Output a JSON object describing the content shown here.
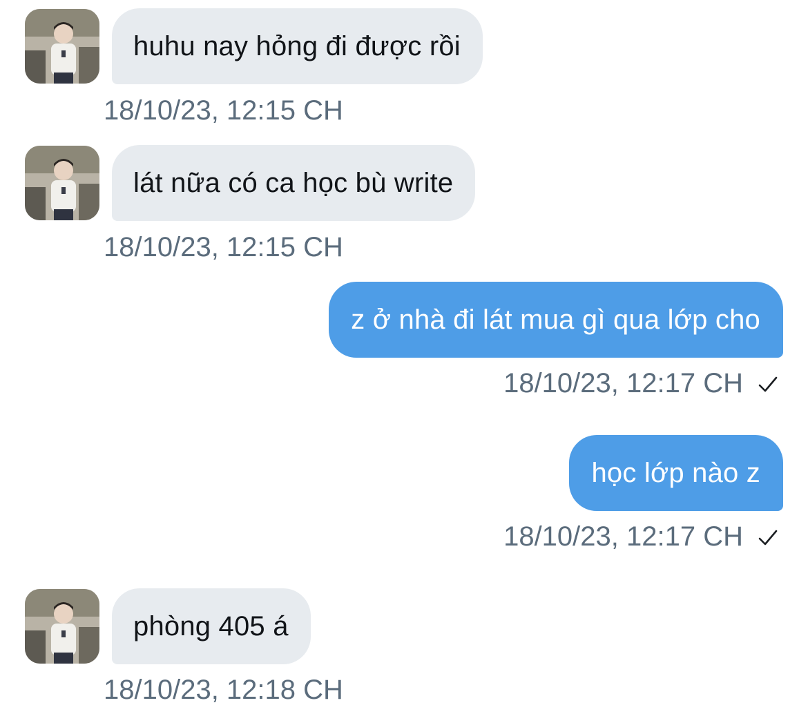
{
  "messages": [
    {
      "direction": "in",
      "text": "huhu nay hỏng đi được rồi",
      "time": "18/10/23, 12:15 CH"
    },
    {
      "direction": "in",
      "text": "lát nữa có ca học bù write",
      "time": "18/10/23, 12:15 CH"
    },
    {
      "direction": "out",
      "text": "z ở nhà đi lát mua gì qua lớp cho",
      "time": "18/10/23, 12:17 CH",
      "status_icon": "checkmark-icon"
    },
    {
      "direction": "out",
      "text": "học lớp nào z",
      "time": "18/10/23, 12:17 CH",
      "status_icon": "checkmark-icon"
    },
    {
      "direction": "in",
      "text": "phòng 405 á",
      "time": "18/10/23, 12:18 CH"
    }
  ],
  "colors": {
    "incoming_bubble": "#e7ebef",
    "outgoing_bubble": "#4e9de7",
    "timestamp": "#5b6c7c"
  }
}
